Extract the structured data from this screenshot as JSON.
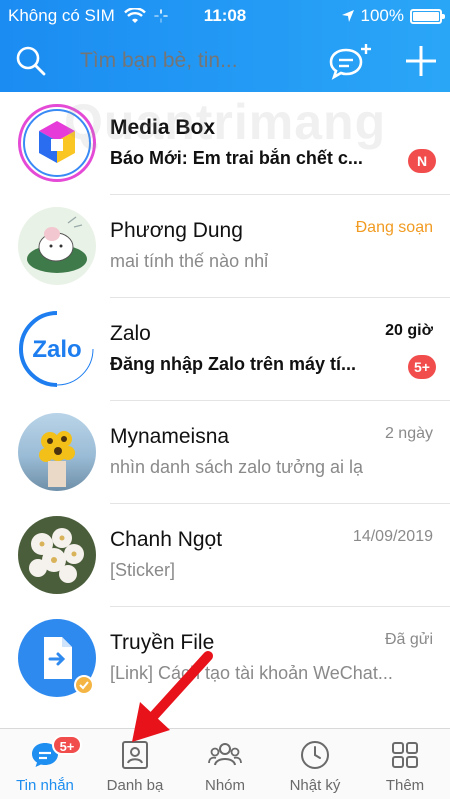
{
  "status_bar": {
    "carrier": "Không có SIM",
    "time": "11:08",
    "battery": "100%"
  },
  "search": {
    "placeholder": "Tìm bạn bè, tin..."
  },
  "icons": {
    "search": "search-icon",
    "compose": "chat-plus-icon",
    "add": "plus-icon"
  },
  "watermark": "Quantrimang",
  "conversations": [
    {
      "name": "Media Box",
      "preview": "Báo Mới: Em trai bắn chết c...",
      "meta": "",
      "badge": "N",
      "unread": true,
      "avatar": "media-box-logo"
    },
    {
      "name": "Phương Dung",
      "preview": "mai tính thế nào nhỉ",
      "meta": "Đang soạn",
      "badge": "",
      "unread": false,
      "avatar": "sticker-avatar"
    },
    {
      "name": "Zalo",
      "preview": "Đăng nhập Zalo trên máy tí...",
      "meta": "20 giờ",
      "badge": "5+",
      "unread": true,
      "avatar": "zalo-logo"
    },
    {
      "name": "Mynameisna",
      "preview": "nhìn danh sách zalo tưởng ai lạ",
      "meta": "2 ngày",
      "badge": "",
      "unread": false,
      "avatar": "sunflower-photo"
    },
    {
      "name": "Chanh Ngọt",
      "preview": "[Sticker]",
      "meta": "14/09/2019",
      "badge": "",
      "unread": false,
      "avatar": "flowers-photo"
    },
    {
      "name": "Truyền File",
      "preview": "[Link] Cách tạo tài khoản WeChat...",
      "meta": "Đã gửi",
      "badge": "",
      "unread": false,
      "avatar": "file-transfer-logo"
    }
  ],
  "tabs": [
    {
      "label": "Tin nhắn",
      "badge": "5+",
      "active": true,
      "icon": "chat-icon"
    },
    {
      "label": "Danh bạ",
      "badge": "",
      "active": false,
      "icon": "contacts-icon"
    },
    {
      "label": "Nhóm",
      "badge": "",
      "active": false,
      "icon": "group-icon"
    },
    {
      "label": "Nhật ký",
      "badge": "",
      "active": false,
      "icon": "clock-icon"
    },
    {
      "label": "Thêm",
      "badge": "",
      "active": false,
      "icon": "grid-icon"
    }
  ],
  "colors": {
    "header": "#1e8ef0",
    "accent": "#1e8ef0",
    "badge": "#f14d4d",
    "typing": "#f19b22",
    "arrow": "#e8121b"
  }
}
